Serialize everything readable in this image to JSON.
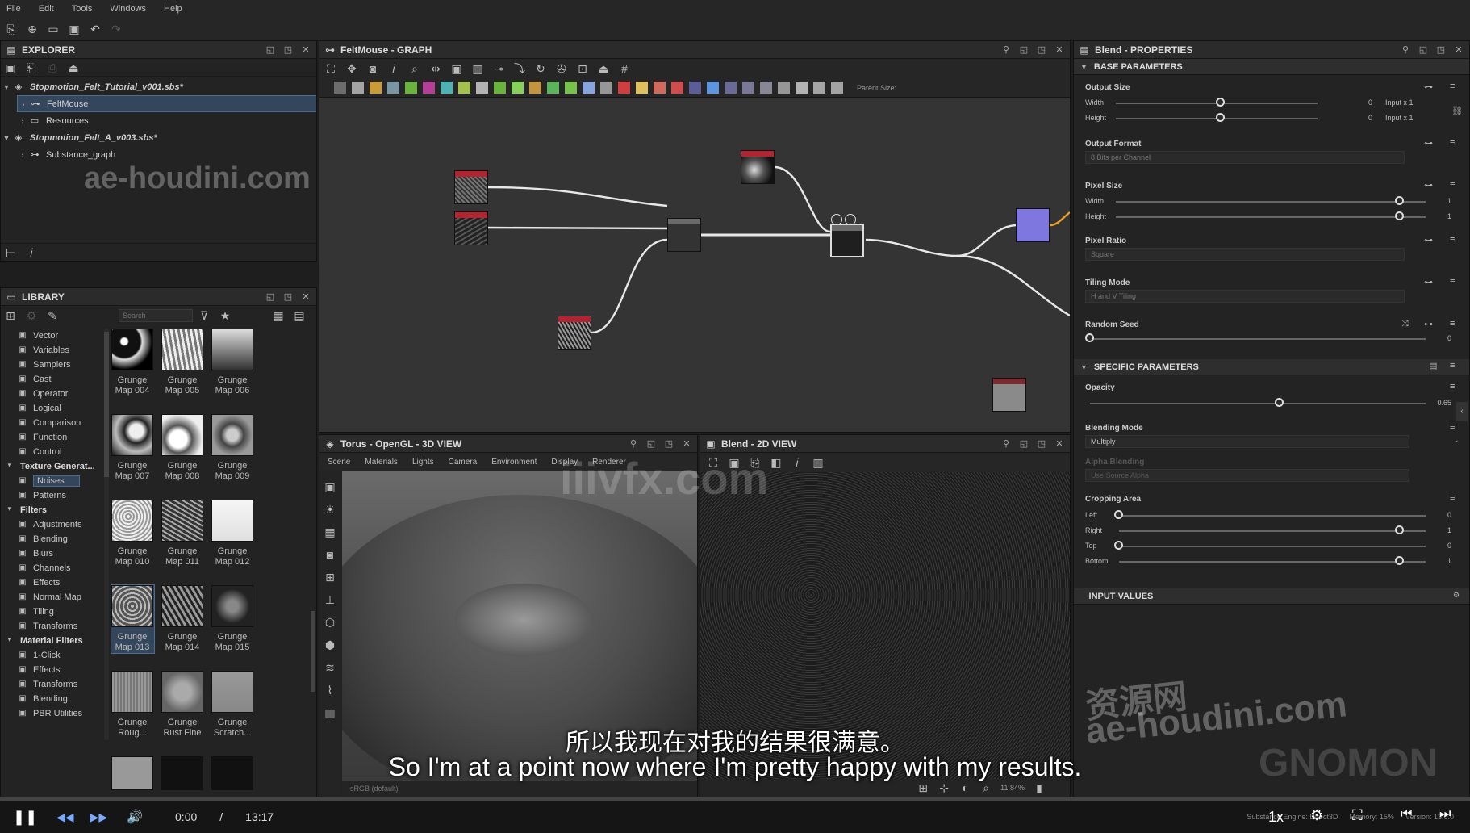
{
  "menu": [
    "File",
    "Edit",
    "Tools",
    "Windows",
    "Help"
  ],
  "explorer": {
    "title": "EXPLORER",
    "tree": [
      {
        "label": "Stopmotion_Felt_Tutorial_v001.sbs*",
        "level": 0,
        "expanded": true,
        "italic": true
      },
      {
        "label": "FeltMouse",
        "level": 1,
        "selected": true
      },
      {
        "label": "Resources",
        "level": 1
      },
      {
        "label": "Stopmotion_Felt_A_v003.sbs*",
        "level": 0,
        "expanded": true,
        "italic": true
      },
      {
        "label": "Substance_graph",
        "level": 1
      }
    ]
  },
  "library": {
    "title": "LIBRARY",
    "search_placeholder": "Search",
    "items": [
      {
        "label": "Vector",
        "type": "item"
      },
      {
        "label": "Variables",
        "type": "item"
      },
      {
        "label": "Samplers",
        "type": "item"
      },
      {
        "label": "Cast",
        "type": "item"
      },
      {
        "label": "Operator",
        "type": "item"
      },
      {
        "label": "Logical",
        "type": "item"
      },
      {
        "label": "Comparison",
        "type": "item"
      },
      {
        "label": "Function",
        "type": "item"
      },
      {
        "label": "Control",
        "type": "item"
      },
      {
        "label": "Texture Generat...",
        "type": "cat"
      },
      {
        "label": "Noises",
        "type": "item",
        "selected": true
      },
      {
        "label": "Patterns",
        "type": "item"
      },
      {
        "label": "Filters",
        "type": "cat"
      },
      {
        "label": "Adjustments",
        "type": "item"
      },
      {
        "label": "Blending",
        "type": "item"
      },
      {
        "label": "Blurs",
        "type": "item"
      },
      {
        "label": "Channels",
        "type": "item"
      },
      {
        "label": "Effects",
        "type": "item"
      },
      {
        "label": "Normal Map",
        "type": "item"
      },
      {
        "label": "Tiling",
        "type": "item"
      },
      {
        "label": "Transforms",
        "type": "item"
      },
      {
        "label": "Material Filters",
        "type": "cat"
      },
      {
        "label": "1-Click",
        "type": "item"
      },
      {
        "label": "Effects",
        "type": "item"
      },
      {
        "label": "Transforms",
        "type": "item"
      },
      {
        "label": "Blending",
        "type": "item"
      },
      {
        "label": "PBR Utilities",
        "type": "item"
      }
    ],
    "thumbs": [
      [
        "Grunge",
        "Map 004"
      ],
      [
        "Grunge",
        "Map 005"
      ],
      [
        "Grunge",
        "Map 006"
      ],
      [
        "Grunge",
        "Map 007"
      ],
      [
        "Grunge",
        "Map 008"
      ],
      [
        "Grunge",
        "Map 009"
      ],
      [
        "Grunge",
        "Map 010"
      ],
      [
        "Grunge",
        "Map 011"
      ],
      [
        "Grunge",
        "Map 012"
      ],
      [
        "Grunge",
        "Map 013"
      ],
      [
        "Grunge",
        "Map 014"
      ],
      [
        "Grunge",
        "Map 015"
      ],
      [
        "Grunge",
        "Roug..."
      ],
      [
        "Grunge",
        "Rust Fine"
      ],
      [
        "Grunge",
        "Scratch..."
      ]
    ],
    "selected_thumb": 9
  },
  "graph": {
    "title": "FeltMouse - GRAPH",
    "parent_size_label": "Parent Size:"
  },
  "view3d": {
    "title": "Torus - OpenGL - 3D VIEW",
    "menu": [
      "Scene",
      "Materials",
      "Lights",
      "Camera",
      "Environment",
      "Display",
      "Renderer"
    ],
    "footer": "sRGB (default)"
  },
  "view2d": {
    "title": "Blend - 2D VIEW",
    "zoom": "11.84%"
  },
  "properties": {
    "title": "Blend - PROPERTIES",
    "base_section": "BASE PARAMETERS",
    "specific_section": "SPECIFIC PARAMETERS",
    "input_section": "INPUT VALUES",
    "output_size": {
      "label": "Output Size",
      "width_label": "Width",
      "height_label": "Height",
      "width_value": "0",
      "height_value": "0",
      "width_mode": "Input x 1",
      "height_mode": "Input x 1"
    },
    "output_format": {
      "label": "Output Format",
      "value": "8 Bits per Channel"
    },
    "pixel_size": {
      "label": "Pixel Size",
      "width_label": "Width",
      "height_label": "Height",
      "width_value": "1",
      "height_value": "1"
    },
    "pixel_ratio": {
      "label": "Pixel Ratio",
      "value": "Square"
    },
    "tiling_mode": {
      "label": "Tiling Mode",
      "value": "H and V Tiling"
    },
    "random_seed": {
      "label": "Random Seed",
      "value": "0"
    },
    "opacity": {
      "label": "Opacity",
      "value": "0.65",
      "fraction": 0.65
    },
    "blending_mode": {
      "label": "Blending Mode",
      "value": "Multiply"
    },
    "alpha_blending": {
      "label": "Alpha Blending",
      "value": "Use Source Alpha"
    },
    "cropping": {
      "label": "Cropping Area",
      "left_label": "Left",
      "right_label": "Right",
      "top_label": "Top",
      "bottom_label": "Bottom",
      "left": "0",
      "right": "1",
      "top": "0",
      "bottom": "1"
    }
  },
  "player": {
    "time_current": "0:00",
    "time_sep": "/",
    "time_total": "13:17",
    "speed": "1x",
    "progress_fraction": 0.0
  },
  "status": {
    "engine": "Substance Engine: Direct3D",
    "memory": "Memory: 15%",
    "version": "Version: 13.0.0"
  },
  "subtitles": {
    "zh": "所以我现在对我的结果很满意。",
    "en": "So I'm at a point now where I'm pretty happy with my results."
  },
  "watermarks": {
    "left": "ae-houdini.com",
    "center": "iiivfx.com",
    "right_zh": "资源网",
    "right": "ae-houdini.com",
    "brand": "GNOMON"
  }
}
